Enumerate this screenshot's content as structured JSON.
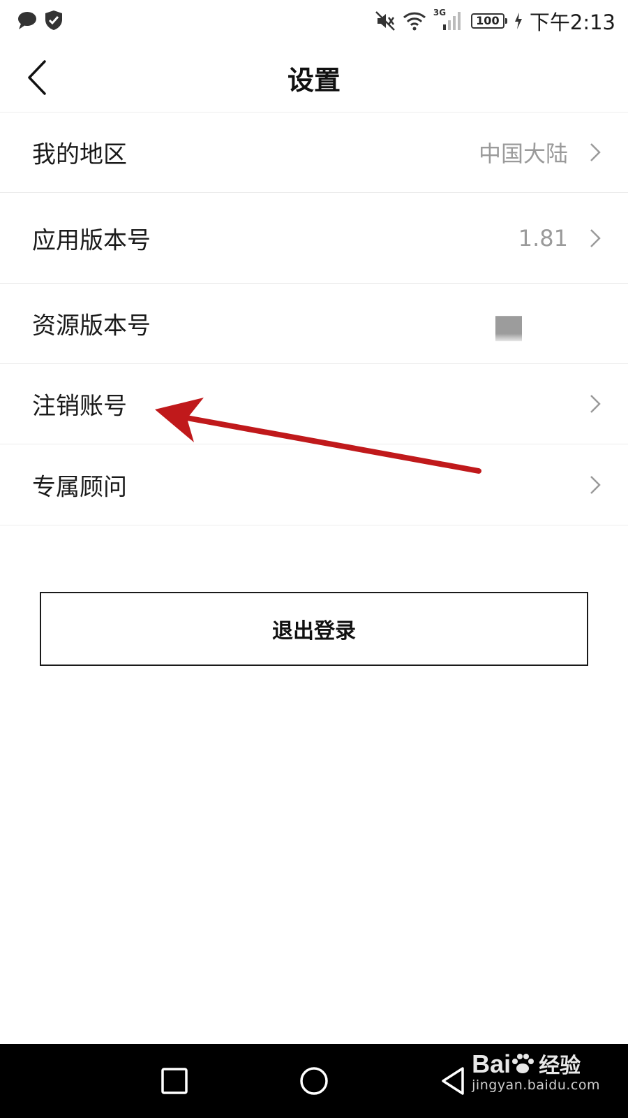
{
  "status_bar": {
    "time": "下午2:13",
    "battery": "100",
    "network": "3G",
    "left_icons": [
      "chat-bubble-icon",
      "shield-check-icon"
    ],
    "right_icons": [
      "mute-icon",
      "wifi-icon",
      "signal-icon",
      "battery-icon",
      "charging-icon"
    ]
  },
  "header": {
    "title": "设置",
    "back_icon": "chevron-left-icon"
  },
  "settings": {
    "items": [
      {
        "label": "我的地区",
        "value": "中国大陆",
        "chevron": true
      },
      {
        "label": "应用版本号",
        "value": "1.81",
        "chevron": true
      },
      {
        "label": "资源版本号",
        "value": "",
        "chevron": false
      },
      {
        "label": "注销账号",
        "value": "",
        "chevron": true
      },
      {
        "label": "专属顾问",
        "value": "",
        "chevron": true
      }
    ]
  },
  "logout": {
    "label": "退出登录"
  },
  "annotation": {
    "color": "#c0191b",
    "target": "注销账号"
  },
  "nav_bar": {
    "buttons": [
      "recent-apps-icon",
      "home-icon",
      "back-triangle-icon"
    ],
    "watermark_logo": "Bai",
    "watermark_logo_cn": "经验",
    "watermark_url": "jingyan.baidu.com"
  },
  "colors": {
    "text": "#1a1a1a",
    "secondary_text": "#9a9a9a",
    "divider": "#ececec",
    "nav_bg": "#000000"
  }
}
